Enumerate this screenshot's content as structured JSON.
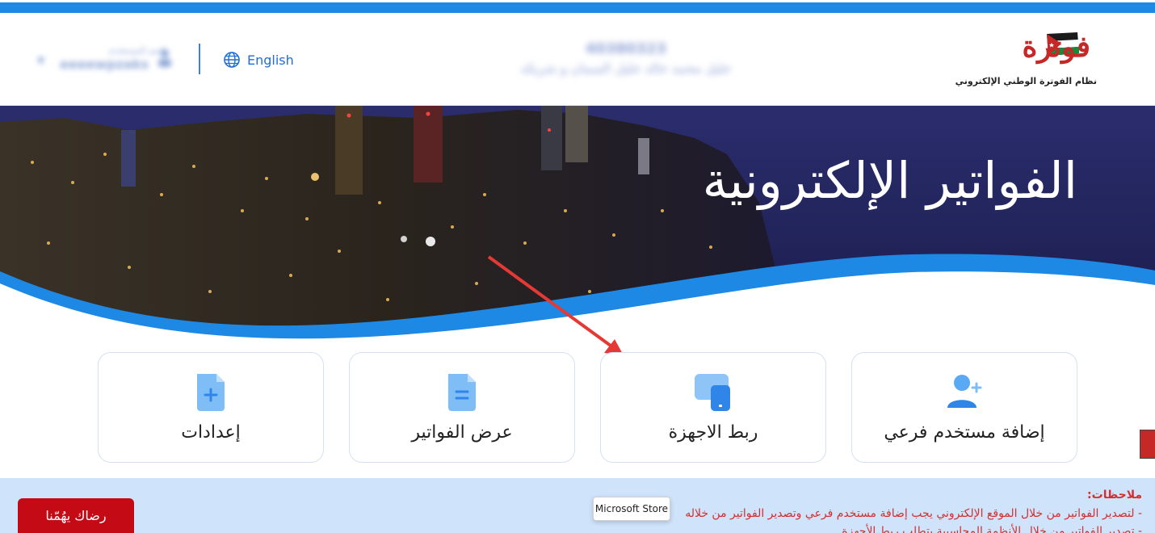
{
  "header": {
    "logo_text": "فوترة",
    "logo_tagline": "نظام الفوترة الوطني الإلكتروني",
    "company_number": "40380323",
    "company_name": "خليل محمد خالد خليل السمان و شريكه",
    "language_label": "English",
    "user_caption": "اسم المستخدم",
    "user_name": "eeeewpzaks"
  },
  "hero": {
    "title": "الفواتير الإلكترونية"
  },
  "cards": [
    {
      "label": "إضافة مستخدم فرعي",
      "icon": "add-user-icon"
    },
    {
      "label": "ربط الاجهزة",
      "icon": "link-devices-icon"
    },
    {
      "label": "عرض الفواتير",
      "icon": "view-invoices-icon"
    },
    {
      "label": "إعدادات",
      "icon": "settings-document-icon"
    }
  ],
  "notes": {
    "title": "ملاحظات:",
    "line1": "- لتصدير الفواتير من خلال الموقع الإلكتروني يجب إضافة مستخدم فرعي وتصدير الفواتير من خلاله",
    "line2": "- تصدير الفواتير من خلال الأنظمة المحاسبية يتطلب ربط الأجهزة"
  },
  "feedback_label": "رضاك يهُمّنا",
  "tooltip_text": "Microsoft Store",
  "colors": {
    "accent": "#1e88e5",
    "brand_red": "#c40a14",
    "hero_navy": "#232656",
    "notes_bg": "#cfe3fb",
    "notes_text": "#d32f2f"
  }
}
